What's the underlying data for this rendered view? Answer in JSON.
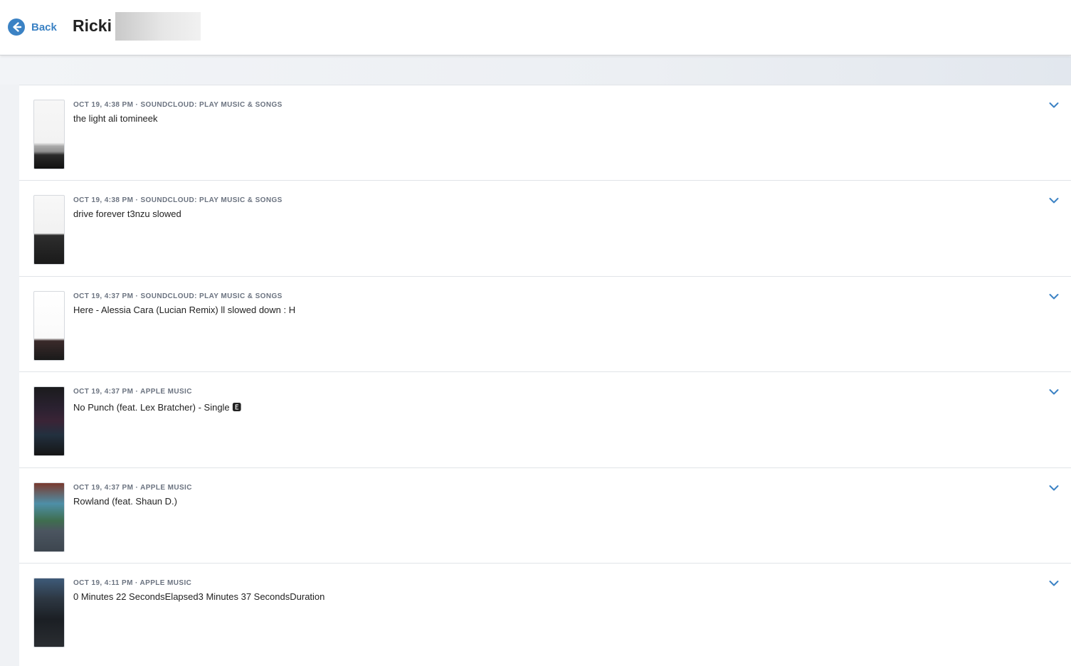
{
  "header": {
    "back_label": "Back",
    "title": "Ricki"
  },
  "colors": {
    "accent": "#3b82c4",
    "meta_text": "#6b7380",
    "divider": "#e1e4e8"
  },
  "items": [
    {
      "meta": "OCT 19, 4:38 PM · SOUNDCLOUD: PLAY MUSIC & SONGS",
      "text": "the light ali tomineek",
      "thumbnail": "soundcloud-search-screenshot"
    },
    {
      "meta": "OCT 19, 4:38 PM · SOUNDCLOUD: PLAY MUSIC & SONGS",
      "text": "drive forever t3nzu slowed",
      "thumbnail": "soundcloud-keyboard-screenshot"
    },
    {
      "meta": "OCT 19, 4:37 PM · SOUNDCLOUD: PLAY MUSIC & SONGS",
      "text": "Here - Alessia Cara (Lucian Remix) ll slowed down : H",
      "thumbnail": "soundcloud-home-screenshot"
    },
    {
      "meta": "OCT 19, 4:37 PM · APPLE MUSIC",
      "text": "No Punch (feat. Lex Bratcher) - Single 🅴",
      "thumbnail": "apple-music-grid-screenshot"
    },
    {
      "meta": "OCT 19, 4:37 PM · APPLE MUSIC",
      "text": "Rowland (feat. Shaun D.)",
      "thumbnail": "apple-music-now-playing-screenshot"
    },
    {
      "meta": "OCT 19, 4:11 PM · APPLE MUSIC",
      "text": "0 Minutes 22 SecondsElapsed3 Minutes 37 SecondsDuration",
      "thumbnail": "apple-music-player-screenshot"
    }
  ]
}
